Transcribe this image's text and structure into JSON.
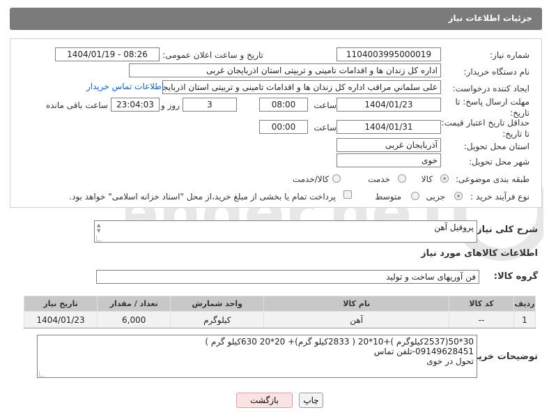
{
  "header": {
    "title": "جزئیات اطلاعات نیاز"
  },
  "form": {
    "need_number_label": "شماره نیاز:",
    "need_number": "1104003995000019",
    "announce_label": "تاریخ و ساعت اعلان عمومی:",
    "announce_value": "1404/01/19 - 08:26",
    "buyer_org_label": "نام دستگاه خریدار:",
    "buyer_org": "اداره کل زندان ها و اقدامات تامینی و تربیتی استان اذربایجان غربی",
    "creator_label": "ایجاد کننده درخواست:",
    "creator": "علی سلماني مراقب اداره کل زندان ها و اقدامات تامینی و تربیتی استان اذربایجا",
    "contact_link": "اطلاعات تماس خریدار",
    "reply_deadline_label": "مهلت ارسال پاسخ: تا تاریخ:",
    "reply_date": "1404/01/23",
    "time_label": "ساعت",
    "reply_time": "08:00",
    "days_value": "3",
    "days_label": "روز و",
    "remaining_time": "23:04:03",
    "remaining_label": "ساعت باقی مانده",
    "price_validity_label": "حداقل تاریخ اعتبار قیمت: تا تاریخ:",
    "price_date": "1404/01/31",
    "price_time": "00:00",
    "delivery_province_label": "استان محل تحویل:",
    "delivery_province": "آذربایجان غربی",
    "delivery_city_label": "شهر محل تحویل:",
    "delivery_city": "خوی",
    "category_label": "طبقه بندی موضوعی:",
    "category_options": [
      "کالا",
      "خدمت",
      "کالا/خدمت"
    ],
    "process_label": "نوع فرآیند خرید :",
    "process_options": [
      "جزیی",
      "متوسط"
    ],
    "payment_note": "پرداخت تمام یا بخشی از مبلغ خرید،از محل \"اسناد خزانه اسلامی\" خواهد بود."
  },
  "summary": {
    "label": "شرح کلی نیاز:",
    "value": "پروفیل آهن"
  },
  "goods_section": {
    "title": "اطلاعات کالاهای مورد نیاز",
    "group_label": "گروه کالا:",
    "group_value": "فن آوریهای ساخت و تولید"
  },
  "table": {
    "headers": [
      "ردیف",
      "کد کالا",
      "نام کالا",
      "واحد شمارش",
      "تعداد / مقدار",
      "تاریخ نیاز"
    ],
    "rows": [
      [
        "1",
        "--",
        "آهن",
        "کیلوگرم",
        "6,000",
        "1404/01/23"
      ]
    ]
  },
  "buyer_notes": {
    "label": "توضیحات خریدار:",
    "lines": [
      "30*50(2537کیلوگرم )+10*20 ( 2833کیلو گرم)+ 20*20 630کیلو گرم )",
      "09149628451-تلفن تماس",
      "تحول در خوی"
    ]
  },
  "buttons": {
    "print": "چاپ",
    "back": "بازگشت"
  },
  "watermark": {
    "text": "AriaTender.neT"
  }
}
